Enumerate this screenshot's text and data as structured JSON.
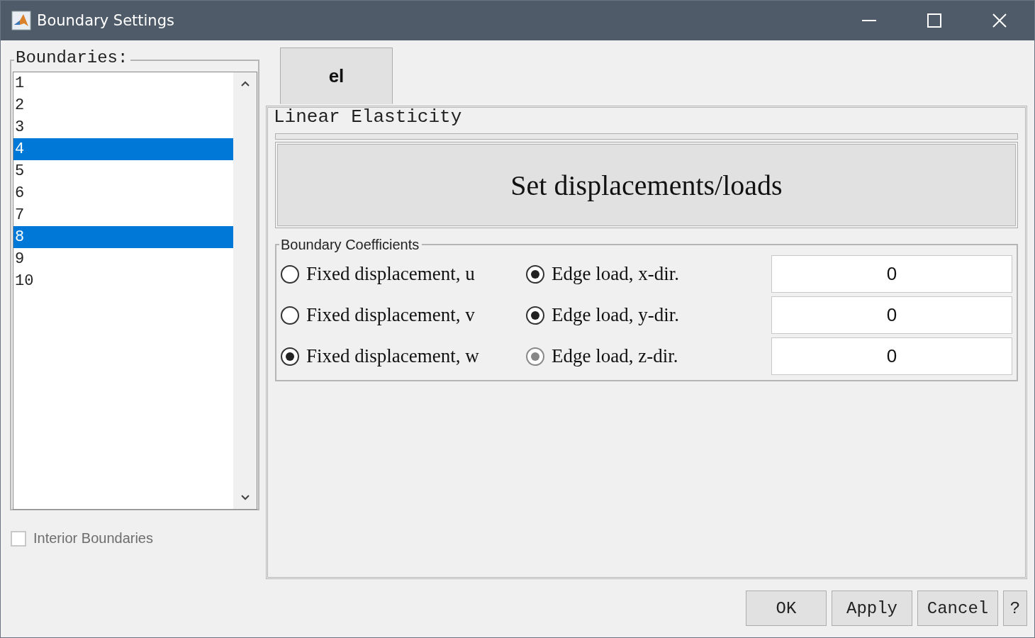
{
  "window": {
    "title": "Boundary Settings"
  },
  "boundaries": {
    "legend": "Boundaries:",
    "items": [
      {
        "label": "1",
        "selected": false
      },
      {
        "label": "2",
        "selected": false
      },
      {
        "label": "3",
        "selected": false
      },
      {
        "label": "4",
        "selected": true
      },
      {
        "label": "5",
        "selected": false
      },
      {
        "label": "6",
        "selected": false
      },
      {
        "label": "7",
        "selected": false
      },
      {
        "label": "8",
        "selected": true
      },
      {
        "label": "9",
        "selected": false
      },
      {
        "label": "10",
        "selected": false
      }
    ]
  },
  "interior_boundaries": {
    "label": "Interior Boundaries",
    "checked": false,
    "disabled": true
  },
  "tabs": [
    {
      "label": "el",
      "selected": true
    }
  ],
  "panel": {
    "legend": "Linear Elasticity",
    "action_button": "Set displacements/loads",
    "coefficients": {
      "legend": "Boundary Coefficients",
      "rows": [
        {
          "options": [
            {
              "label": "Fixed displacement, u",
              "selected": false,
              "disabled": false
            },
            {
              "label": "Edge load, x-dir.",
              "selected": true,
              "disabled": false
            }
          ],
          "value": "0"
        },
        {
          "options": [
            {
              "label": "Fixed displacement, v",
              "selected": false,
              "disabled": false
            },
            {
              "label": "Edge load, y-dir.",
              "selected": true,
              "disabled": false
            }
          ],
          "value": "0"
        },
        {
          "options": [
            {
              "label": "Fixed displacement, w",
              "selected": true,
              "disabled": false
            },
            {
              "label": "Edge load, z-dir.",
              "selected": true,
              "disabled": true
            }
          ],
          "value": "0"
        }
      ]
    }
  },
  "buttons": [
    "OK",
    "Apply",
    "Cancel",
    "?"
  ]
}
